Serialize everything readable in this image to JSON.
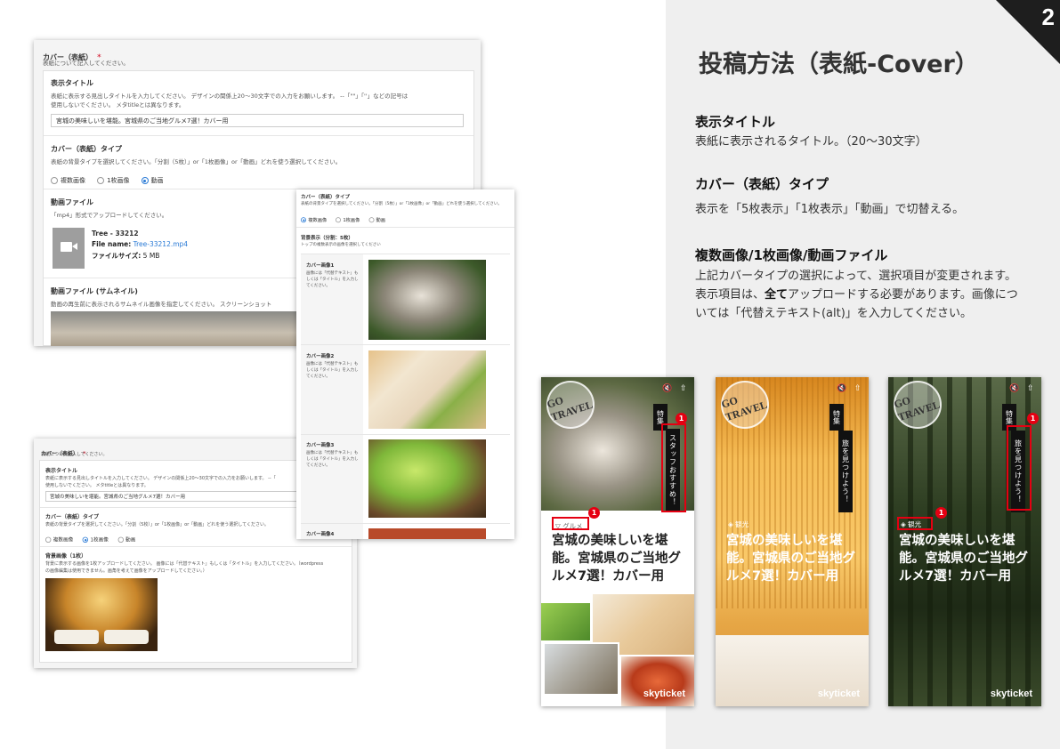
{
  "slide_number": "2",
  "main_title": "投稿方法（表紙-Cover）",
  "sections": [
    {
      "heading": "表示タイトル",
      "body": "表紙に表示されるタイトル。（20〜30文字）"
    },
    {
      "heading": "カバー（表紙）タイプ",
      "body": "表示を「5枚表示」「1枚表示」「動画」で切替える。"
    },
    {
      "heading": "複数画像/1枚画像/動画ファイル",
      "body_before": "上記カバータイプの選択によって、選択項目が変更されます。表示項目は、",
      "body_bold": "全て",
      "body_after": "アップロードする必要があります。画像については「代替えテキスト(alt)」を入力してください。"
    }
  ],
  "form1": {
    "cover_label": "カバー（表紙）",
    "required": "*",
    "cover_hint": "表紙について記入してください。",
    "title_label": "表示タイトル",
    "title_hint1": "表紙に表示する見出しタイトルを入力してください。 デザインの関係上20〜30文字での入力をお願いします。 --「\"\"」「''」などの記号は",
    "title_hint2": "使用しないでください。 メタtitleとは異なります。",
    "title_value": "宮城の美味しいを堪能。宮城県のご当地グルメ7選！カバー用",
    "type_label": "カバー（表紙）タイプ",
    "type_hint": "表紙の背景タイプを選択してください。「分割（5枚）」or「1枚画像」or「動画」どれを使う選択してください。",
    "radio": [
      "複数画像",
      "1枚画像",
      "動画"
    ],
    "video_label": "動画ファイル",
    "video_hint": "「mp4」形式でアップロードしてください。",
    "file_title": "Tree - 33212",
    "file_name_label": "File name:",
    "file_name": "Tree-33212.mp4",
    "file_size_label": "ファイルサイズ:",
    "file_size": "5 MB",
    "thumb_label": "動画ファイル (サムネイル)",
    "thumb_hint": "動画の再生前に表示されるサムネイル画像を指定してください。 スクリーンショット"
  },
  "form2": {
    "type_label": "カバー（表紙）タイプ",
    "type_hint": "表紙の背景タイプを選択してください。「分割（5枚）」or「1枚画像」or「動画」どれを使う選択してください。",
    "radio": [
      "複数画像",
      "1枚画像",
      "動画"
    ],
    "bg_label": "背景表示（分割：5枚）",
    "bg_hint": "トップの複数表示の画像を選択してください",
    "rows": [
      {
        "label": "カバー画像1",
        "hint": "画像には「代替テキスト」もしくは「タイトル」を入力してください。"
      },
      {
        "label": "カバー画像2",
        "hint": "画像には「代替テキスト」もしくは「タイトル」を入力してください。"
      },
      {
        "label": "カバー画像3",
        "hint": "画像には「代替テキスト」もしくは「タイトル」を入力してください。"
      },
      {
        "label": "カバー画像4",
        "hint": ""
      }
    ]
  },
  "form3": {
    "cover_label": "カバー（表紙）",
    "required": "*",
    "cover_hint": "表紙について記入してください。",
    "title_label": "表示タイトル",
    "title_hint1": "表紙に表示する見出しタイトルを入力してください。 デザインの関係上20〜30文字での入力をお願いします。 --「",
    "title_hint2": "使用しないでください。 メタtitleとは異なります。",
    "title_value": "宮城の美味しいを堪能。宮城県のご当地グルメ7選！カバー用",
    "type_label": "カバー（表紙）タイプ",
    "type_hint": "表紙の背景タイプを選択してください。「分割（5枚）」or「1枚画像」or「動画」どれを使う選択してください。",
    "radio": [
      "複数画像",
      "1枚画像",
      "動画"
    ],
    "bg_label": "背景画像（1枚）",
    "bg_hint1": "背景に表示する画像を1枚アップロードしてください。 画像には「代替テキスト」もしくは「タイトル」を入力してください。（wordpress",
    "bg_hint2": "の画像編集は使用できません。画角を考えて画像をアップロードしてください。）"
  },
  "phones": [
    {
      "title": "宮城の美味しいを堪能。宮城県のご当地グルメ7選！カバー用",
      "tokushu": "特集",
      "vtag": "スタッフおすすめ！",
      "category": "グルメ",
      "brand": "skyticket",
      "badge": "1"
    },
    {
      "title": "宮城の美味しいを堪能。宮城県のご当地グルメ7選！カバー用",
      "tokushu": "特集",
      "vtag": "旅を見つけよう！",
      "category": "観光",
      "brand": "skyticket"
    },
    {
      "title": "宮城の美味しいを堪能。宮城県のご当地グルメ7選！カバー用",
      "tokushu": "特集",
      "vtag": "旅を見つけよう！",
      "category": "観光",
      "brand": "skyticket",
      "badge": "1"
    }
  ],
  "logo_text": "GO TRAVEL",
  "colors": {
    "accent_red": "#e50012",
    "radio_blue": "#2b7bd6",
    "panel_bg": "#efefef",
    "corner": "#1e1e1e"
  }
}
